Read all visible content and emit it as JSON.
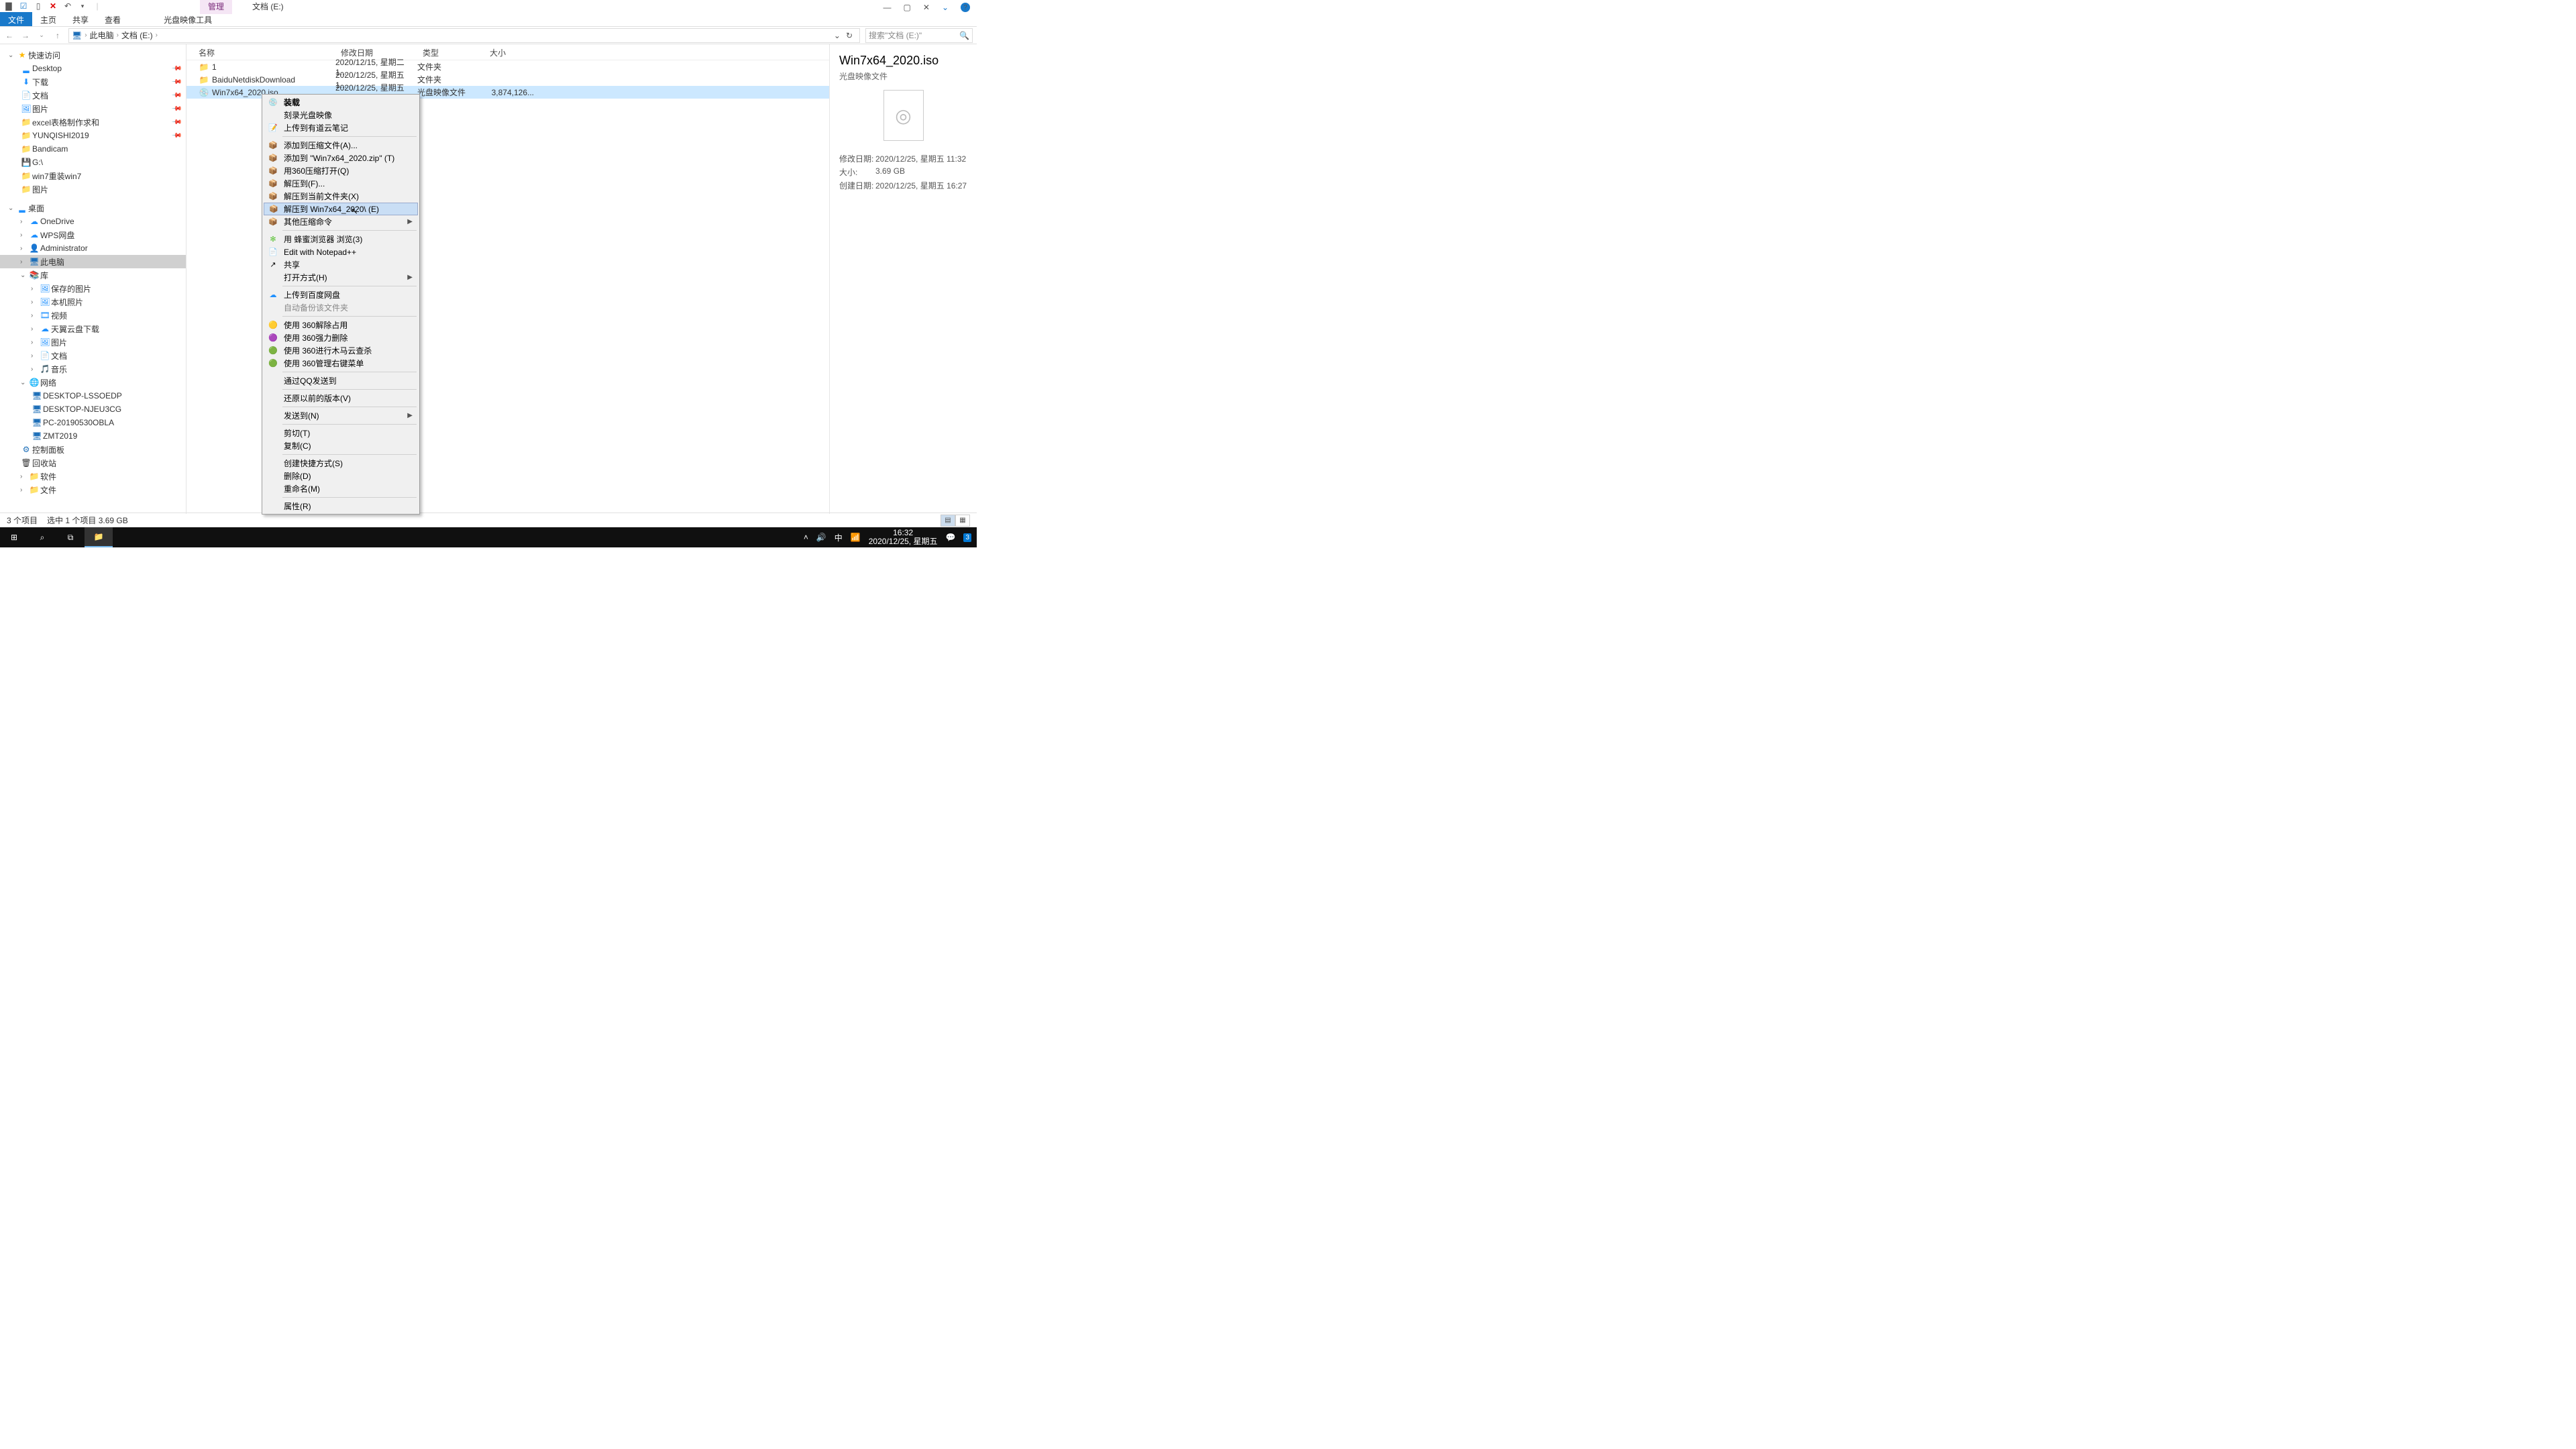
{
  "window": {
    "title": "文档 (E:)"
  },
  "ribbon": {
    "tool_tab": "管理",
    "file": "文件",
    "home": "主页",
    "share": "共享",
    "view": "查看",
    "disc_tool": "光盘映像工具"
  },
  "win_controls": {
    "min": "—",
    "max": "▢",
    "close": "✕"
  },
  "breadcrumb": {
    "root": "此电脑",
    "drive": "文档 (E:)"
  },
  "search": {
    "placeholder": "搜索\"文档 (E:)\""
  },
  "columns": {
    "name": "名称",
    "date": "修改日期",
    "type": "类型",
    "size": "大小"
  },
  "files": [
    {
      "name": "1",
      "date": "2020/12/15, 星期二 1...",
      "type": "文件夹",
      "size": ""
    },
    {
      "name": "BaiduNetdiskDownload",
      "date": "2020/12/25, 星期五 1...",
      "type": "文件夹",
      "size": ""
    },
    {
      "name": "Win7x64_2020.iso",
      "date": "2020/12/25, 星期五 1...",
      "type": "光盘映像文件",
      "size": "3,874,126..."
    }
  ],
  "tree": {
    "quick": "快速访问",
    "items1": [
      "Desktop",
      "下载",
      "文档",
      "图片",
      "excel表格制作求和",
      "YUNQISHI2019",
      "Bandicam",
      "G:\\",
      "win7重装win7",
      "图片"
    ],
    "desktop": "桌面",
    "items2": [
      "OneDrive",
      "WPS网盘",
      "Administrator",
      "此电脑",
      "库"
    ],
    "lib": [
      "保存的图片",
      "本机照片",
      "视频",
      "天翼云盘下载",
      "图片",
      "文档",
      "音乐"
    ],
    "network": "网络",
    "net_items": [
      "DESKTOP-LSSOEDP",
      "DESKTOP-NJEU3CG",
      "PC-20190530OBLA",
      "ZMT2019"
    ],
    "bottom": [
      "控制面板",
      "回收站",
      "软件",
      "文件"
    ]
  },
  "ctx": {
    "mount": "装载",
    "burn": "刻录光盘映像",
    "youdao": "上传到有道云笔记",
    "add_archive": "添加到压缩文件(A)...",
    "add_zip": "添加到 \"Win7x64_2020.zip\" (T)",
    "open_360zip": "用360压缩打开(Q)",
    "extract_to": "解压到(F)...",
    "extract_here": "解压到当前文件夹(X)",
    "extract_named": "解压到 Win7x64_2020\\ (E)",
    "other_zip": "其他压缩命令",
    "honey": "用 蜂蜜浏览器 浏览(3)",
    "npp": "Edit with Notepad++",
    "share": "共享",
    "open_with": "打开方式(H)",
    "baidu": "上传到百度网盘",
    "autobackup": "自动备份该文件夹",
    "unlock360": "使用 360解除占用",
    "forcedel360": "使用 360强力删除",
    "trojan360": "使用 360进行木马云查杀",
    "manage360": "使用 360管理右键菜单",
    "qq": "通过QQ发送到",
    "restore": "还原以前的版本(V)",
    "sendto": "发送到(N)",
    "cut": "剪切(T)",
    "copy": "复制(C)",
    "shortcut": "创建快捷方式(S)",
    "delete": "删除(D)",
    "rename": "重命名(M)",
    "props": "属性(R)"
  },
  "details": {
    "title": "Win7x64_2020.iso",
    "subtitle": "光盘映像文件",
    "k_moddate": "修改日期:",
    "v_moddate": "2020/12/25, 星期五 11:32",
    "k_size": "大小:",
    "v_size": "3.69 GB",
    "k_created": "创建日期:",
    "v_created": "2020/12/25, 星期五 16:27"
  },
  "status": {
    "count": "3 个项目",
    "sel": "选中 1 个项目  3.69 GB"
  },
  "taskbar": {
    "ime": "中",
    "time": "16:32",
    "date": "2020/12/25, 星期五",
    "notif": "3"
  }
}
